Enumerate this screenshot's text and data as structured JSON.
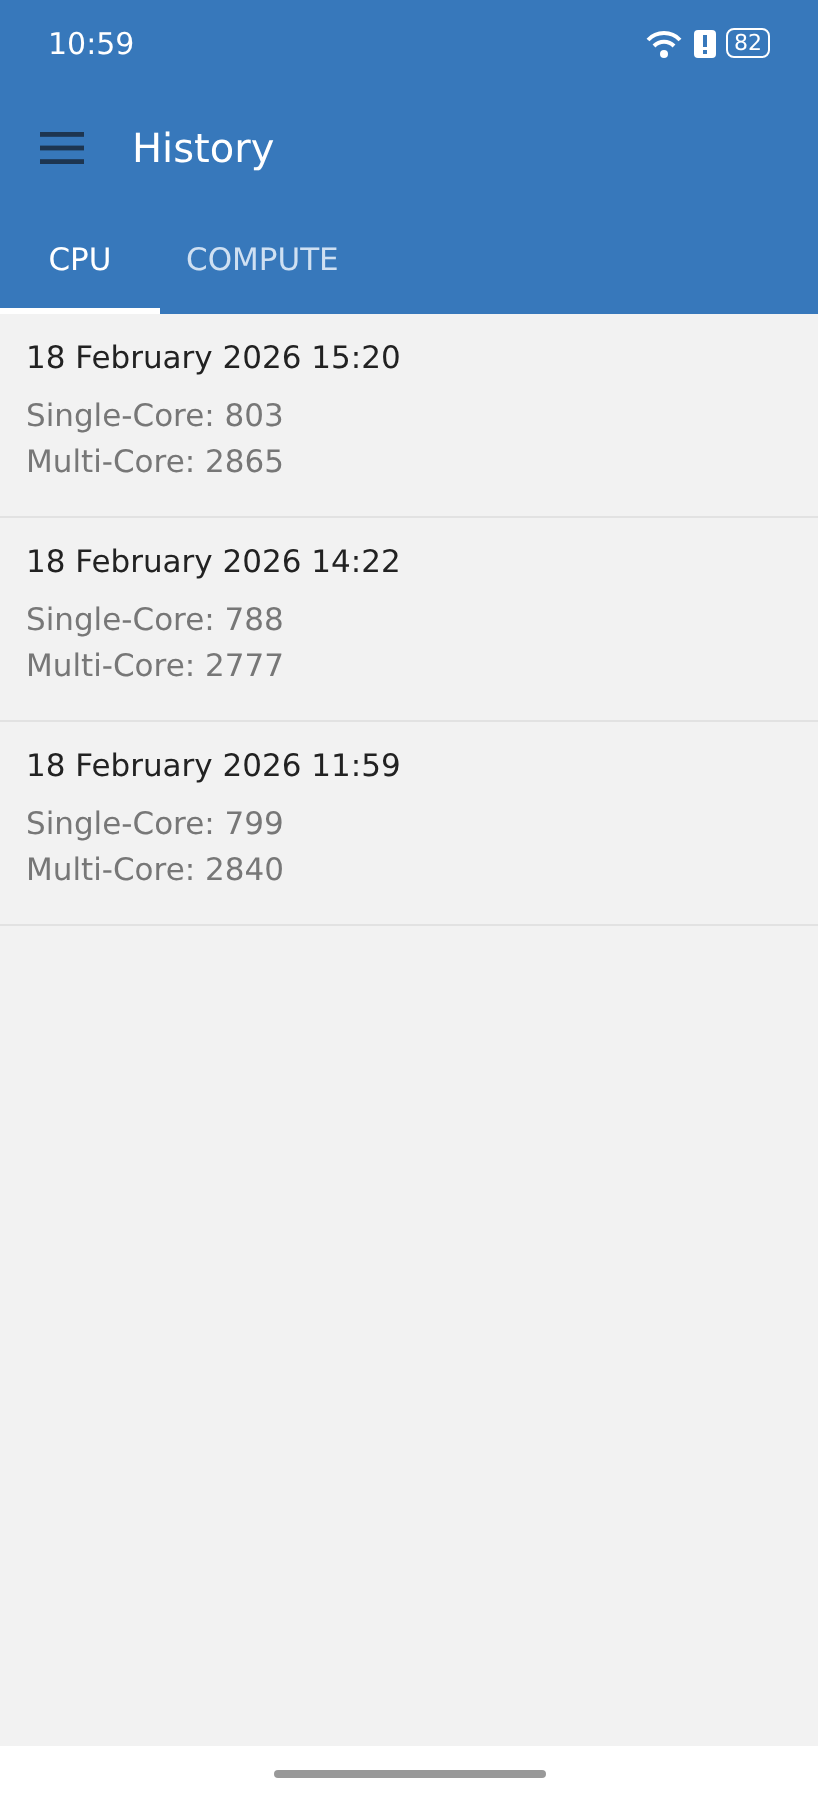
{
  "status_bar": {
    "time": "10:59",
    "battery": "82"
  },
  "app_bar": {
    "title": "History"
  },
  "tabs": [
    {
      "label": "CPU",
      "selected": true
    },
    {
      "label": "COMPUTE",
      "selected": false
    }
  ],
  "results": [
    {
      "date": "18 February 2026 15:20",
      "single_core": "Single-Core: 803",
      "multi_core": "Multi-Core: 2865"
    },
    {
      "date": "18 February 2026 14:22",
      "single_core": "Single-Core: 788",
      "multi_core": "Multi-Core: 2777"
    },
    {
      "date": "18 February 2026 11:59",
      "single_core": "Single-Core: 799",
      "multi_core": "Multi-Core: 2840"
    }
  ]
}
